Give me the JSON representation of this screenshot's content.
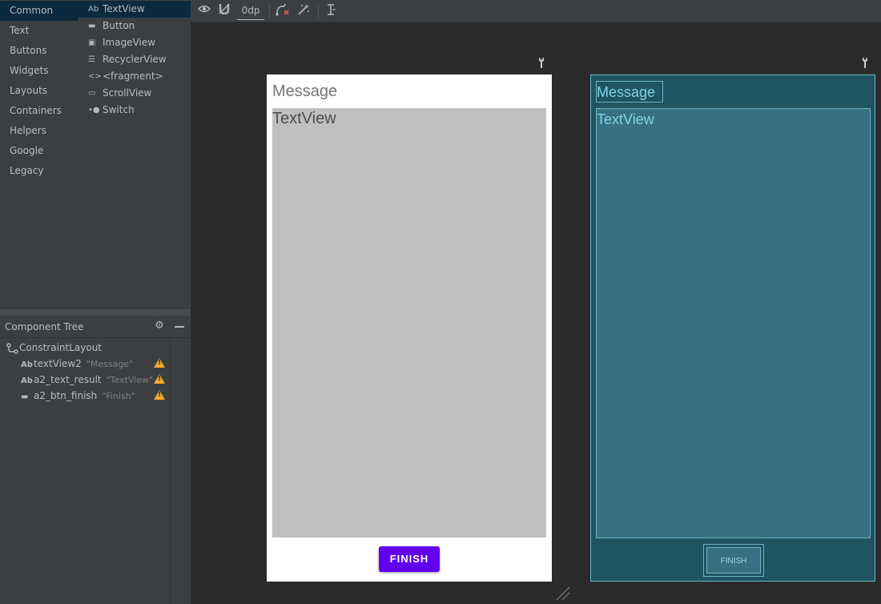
{
  "palette": {
    "categories": [
      {
        "label": "Common",
        "selected": true
      },
      {
        "label": "Text"
      },
      {
        "label": "Buttons"
      },
      {
        "label": "Widgets"
      },
      {
        "label": "Layouts"
      },
      {
        "label": "Containers"
      },
      {
        "label": "Helpers"
      },
      {
        "label": "Google"
      },
      {
        "label": "Legacy"
      }
    ],
    "items": [
      {
        "icon": "Ab",
        "icon_name": "textview-icon",
        "label": "TextView",
        "selected": true
      },
      {
        "icon": "▬",
        "icon_name": "button-icon",
        "label": "Button"
      },
      {
        "icon": "▣",
        "icon_name": "imageview-icon",
        "label": "ImageView"
      },
      {
        "icon": "☰",
        "icon_name": "recyclerview-icon",
        "label": "RecyclerView"
      },
      {
        "icon": "<>",
        "icon_name": "fragment-icon",
        "label": "<fragment>"
      },
      {
        "icon": "▭",
        "icon_name": "scrollview-icon",
        "label": "ScrollView"
      },
      {
        "icon": "•●",
        "icon_name": "switch-icon",
        "label": "Switch"
      }
    ]
  },
  "component_tree": {
    "title": "Component Tree",
    "root": {
      "icon_name": "constraint-layout-icon",
      "label": "ConstraintLayout"
    },
    "nodes": [
      {
        "icon": "Ab",
        "icon_name": "textview-icon",
        "id": "textView2",
        "hint": "\"Message\"",
        "warning": true
      },
      {
        "icon": "Ab",
        "icon_name": "textview-icon",
        "id": "a2_text_result",
        "hint": "\"TextView\"",
        "warning": true
      },
      {
        "icon": "▬",
        "icon_name": "button-icon",
        "id": "a2_btn_finish",
        "hint": "\"Finish\"",
        "warning": true
      }
    ]
  },
  "toolbar": {
    "default_margin": "0dp",
    "icons": [
      "eye-icon",
      "magnet-icon",
      "clear-constraints-icon",
      "infer-constraints-icon",
      "guidelines-icon"
    ]
  },
  "design": {
    "message_text": "Message",
    "textview_text": "TextView",
    "button_text": "FINISH"
  },
  "blueprint": {
    "message_text": "Message",
    "textview_text": "TextView",
    "button_text": "FINISH"
  },
  "colors": {
    "ide_background": "#2b2b2b",
    "panel": "#3c3f41",
    "selection": "#0d293e",
    "button_purple": "#6200ee",
    "blueprint_bg": "#1f5462",
    "warning": "#f0a732"
  }
}
